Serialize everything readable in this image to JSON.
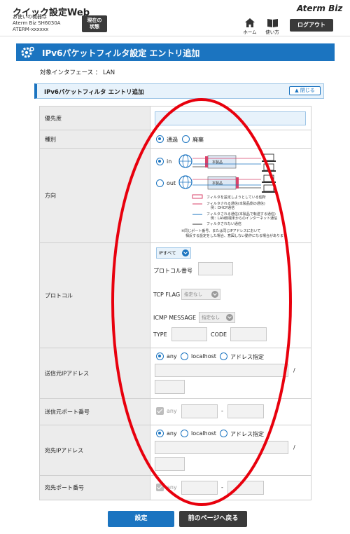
{
  "header": {
    "app_title": "クイック設定Web",
    "device_label": "お使いの機器は",
    "device_model": "Aterm Biz SH6030A",
    "device_id": "ATERM-xxxxxx",
    "current_status_line1": "現在の",
    "current_status_line2": "状態",
    "brand": "Aterm Biz",
    "home_label": "ホーム",
    "howto_label": "使い方",
    "logout_label": "ログアウト"
  },
  "page": {
    "title": "IPv6パケットフィルタ設定 エントリ追加",
    "interface_text": "対象インタフェース ： LAN"
  },
  "section": {
    "title": "IPv6パケットフィルタ エントリ追加",
    "close_label": "閉じる"
  },
  "form": {
    "priority": {
      "label": "優先度",
      "value": ""
    },
    "type": {
      "label": "種別",
      "options": [
        "通過",
        "廃棄"
      ],
      "selected": "通過"
    },
    "direction": {
      "label": "方向",
      "in_label": "in",
      "out_label": "out",
      "selected": "in",
      "device_label": "本製品",
      "legend": [
        "フィルタを設定しようとしている個所",
        "フィルタされる通信(本製品側の通信)",
        "例：DHCP通信",
        "フィルタされる通信(本製品で転送する通信)",
        "例：LAN側端末からのインターネット通信",
        "フィルタされない通信"
      ],
      "note_line1": "※同じポート番号、または同じIPアドレスにおいて",
      "note_line2": "相反する設定をした場合、意図しない動作になる場合があります"
    },
    "protocol": {
      "label": "プロトコル",
      "select_value": "IPすべて",
      "protocol_number_label": "プロトコル番号",
      "tcp_flag_label": "TCP FLAG",
      "tcp_flag_value": "指定なし",
      "icmp_label": "ICMP MESSAGE",
      "icmp_value": "指定なし",
      "type_label": "TYPE",
      "code_label": "CODE"
    },
    "src_ip": {
      "label": "送信元IPアドレス",
      "options": [
        "any",
        "localhost",
        "アドレス指定"
      ],
      "selected": "any",
      "slash": "/"
    },
    "src_port": {
      "label": "送信元ポート番号",
      "any_label": "any",
      "dash": "-"
    },
    "dst_ip": {
      "label": "宛先IPアドレス",
      "options": [
        "any",
        "localhost",
        "アドレス指定"
      ],
      "selected": "any",
      "slash": "/"
    },
    "dst_port": {
      "label": "宛先ポート番号",
      "any_label": "any",
      "dash": "-"
    }
  },
  "footer": {
    "set_label": "設定",
    "back_label": "前のページへ戻る"
  },
  "colors": {
    "accent": "#1b74c0",
    "dark_button": "#3a3a3a",
    "annotation": "#e8000d"
  }
}
